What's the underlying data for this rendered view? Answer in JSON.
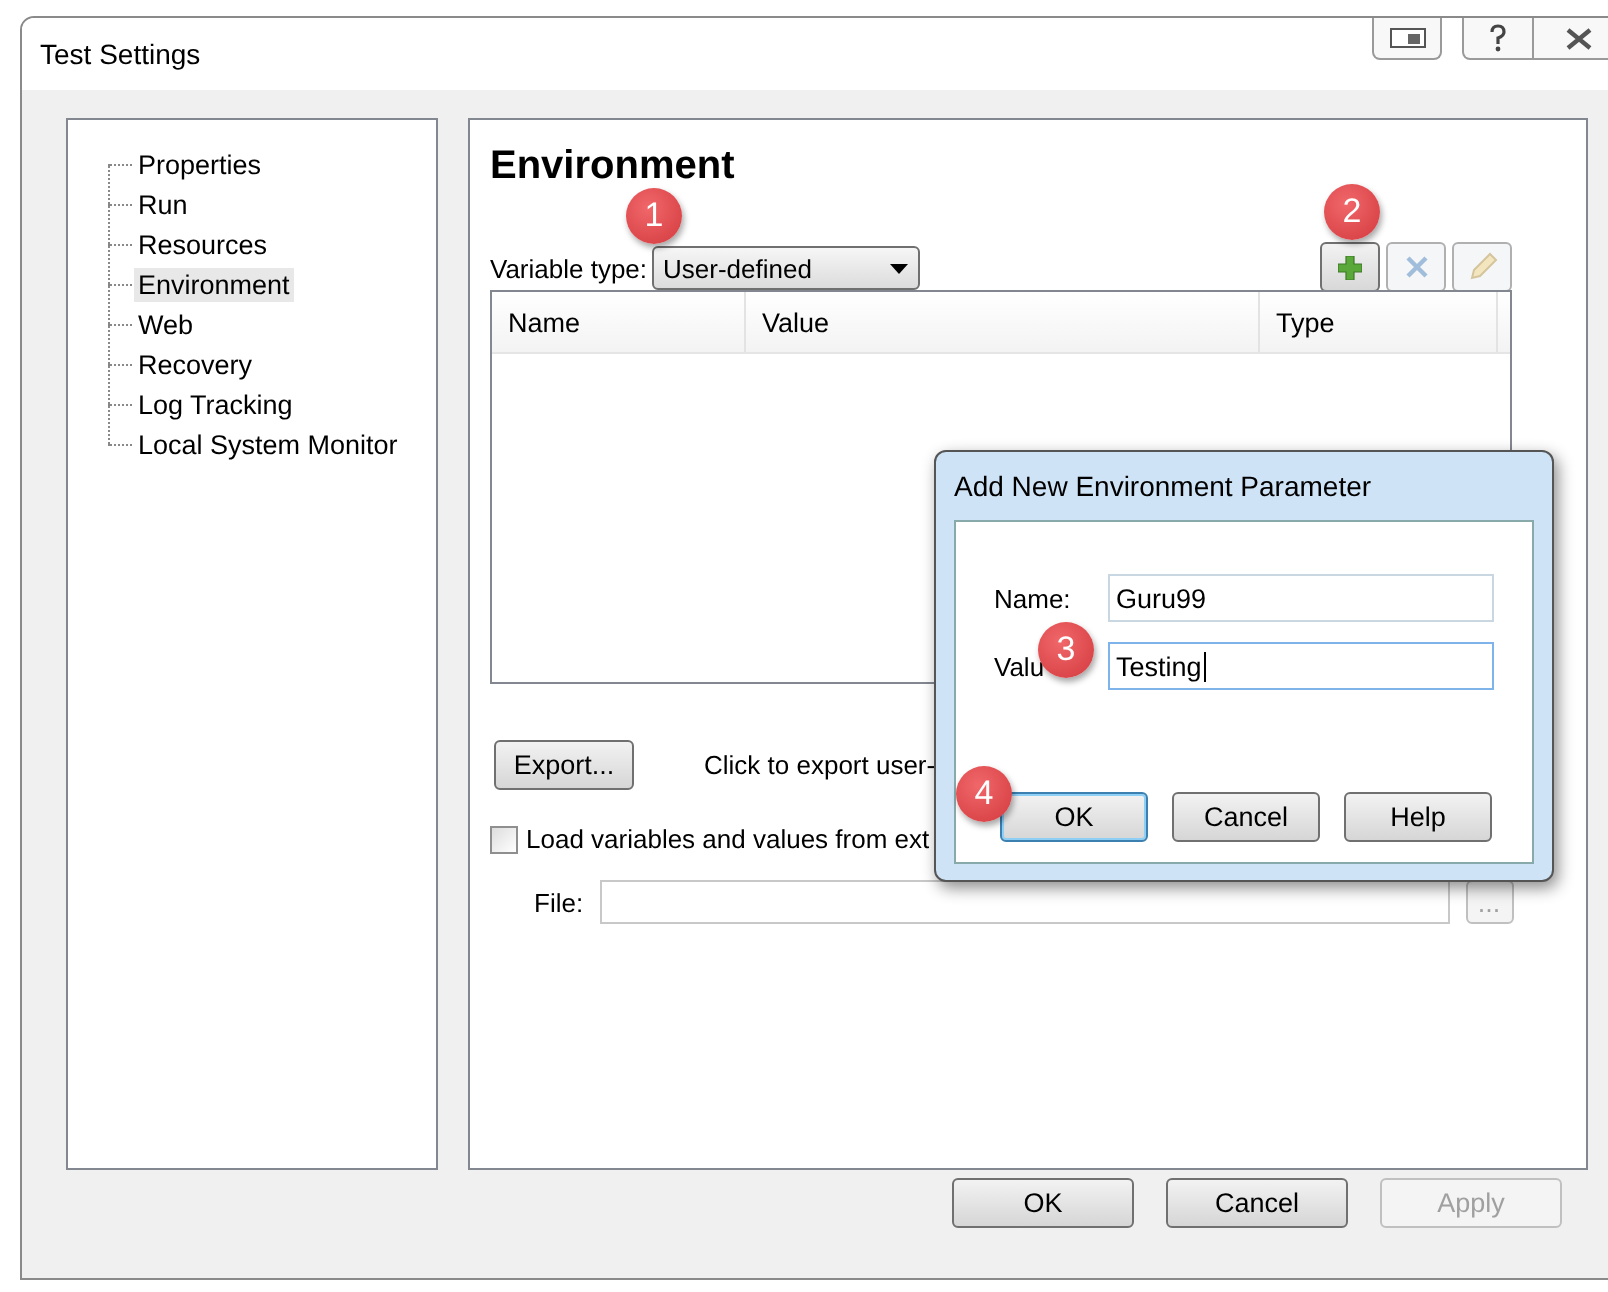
{
  "window": {
    "title": "Test Settings"
  },
  "tree": [
    {
      "label": "Properties",
      "selected": false
    },
    {
      "label": "Run",
      "selected": false
    },
    {
      "label": "Resources",
      "selected": false
    },
    {
      "label": "Environment",
      "selected": true
    },
    {
      "label": "Web",
      "selected": false
    },
    {
      "label": "Recovery",
      "selected": false
    },
    {
      "label": "Log Tracking",
      "selected": false
    },
    {
      "label": "Local System Monitor",
      "selected": false
    }
  ],
  "environment": {
    "heading": "Environment",
    "variable_type": {
      "label": "Variable type:",
      "value": "User-defined"
    },
    "toolbar": [
      {
        "kind": "add",
        "disabled": false
      },
      {
        "kind": "delete",
        "disabled": true
      },
      {
        "kind": "edit",
        "disabled": true
      }
    ],
    "table": {
      "columns": [
        "Name",
        "Value",
        "Type"
      ]
    },
    "export": {
      "button": "Export...",
      "hint": "Click to export user-"
    },
    "load": {
      "label": "Load variables and values from ext",
      "checked": false
    },
    "file": {
      "label": "File:",
      "browse": "..."
    }
  },
  "dialog": {
    "title": "Add New Environment Parameter",
    "fields": [
      {
        "label": "Name:",
        "value": "Guru99"
      },
      {
        "label": "Valu",
        "value": "Testing"
      }
    ],
    "buttons": [
      {
        "label": "OK",
        "default": true
      },
      {
        "label": "Cancel",
        "default": false
      },
      {
        "label": "Help",
        "default": false
      }
    ]
  },
  "buttons": [
    {
      "label": "OK",
      "disabled": false
    },
    {
      "label": "Cancel",
      "disabled": false
    },
    {
      "label": "Apply",
      "disabled": true
    }
  ],
  "annotations": [
    "1",
    "2",
    "3",
    "4"
  ]
}
